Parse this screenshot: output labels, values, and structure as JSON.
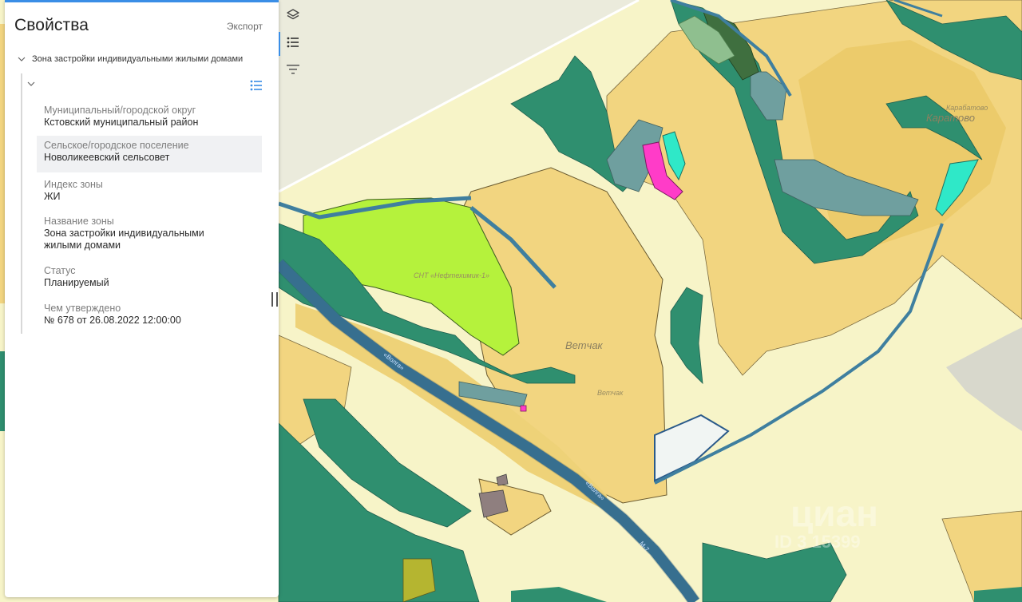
{
  "panel": {
    "title": "Свойства",
    "export_label": "Экспорт",
    "tree_root_label": "Зона застройки индивидуальными жилыми домами",
    "properties": [
      {
        "label": "Муниципальный/городской округ",
        "value": "Кстовский муниципальный район",
        "highlighted": false
      },
      {
        "label": "Сельское/городское поселение",
        "value": "Новоликеевский сельсовет",
        "highlighted": true
      },
      {
        "label": "Индекс зоны",
        "value": "ЖИ",
        "highlighted": false
      },
      {
        "label": "Название зоны",
        "value": "Зона застройки индивидуальными жилыми домами",
        "highlighted": false
      },
      {
        "label": "Статус",
        "value": "Планируемый",
        "highlighted": false
      },
      {
        "label": "Чем утверждено",
        "value": "№ 678 от 26.08.2022 12:00:00",
        "highlighted": false
      }
    ]
  },
  "toolbar": {
    "icons": [
      "layers-icon",
      "list-icon",
      "filter-icon"
    ],
    "active": "list-icon"
  },
  "map": {
    "labels": {
      "vetchak_big": "Ветчак",
      "vetchak_small": "Ветчак",
      "karabatovo_big": "Каратово",
      "karabatovo_small": "Карабатово",
      "snt": "СНТ «Нефтехимик-1»",
      "road_volga_1": "«Волга»",
      "road_volga_2": "«Волга»",
      "road_m": "М-7"
    },
    "watermark": {
      "brand": "циан",
      "id_text": "ID 3 15399"
    },
    "colors": {
      "background": "#f7f4c8",
      "residential_zone": "#f2d580",
      "residential_zone_dark": "#e8c45e",
      "forest_zone": "#2f8f6f",
      "recreation_zone": "#b5f23c",
      "road": "#3f7f9f",
      "agri_zone": "#6f9f9f",
      "industrial_pink": "#ff3cc8",
      "cyan_zone": "#2fe8c8",
      "panel_accent": "#3a8ee6"
    }
  }
}
